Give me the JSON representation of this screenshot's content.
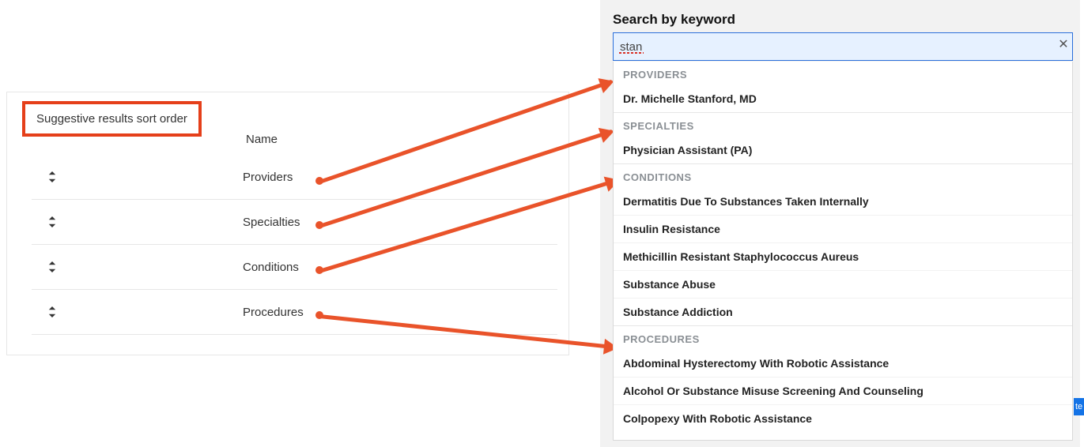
{
  "left": {
    "title": "Suggestive results sort order",
    "column_header": "Name",
    "rows": [
      {
        "label": "Providers"
      },
      {
        "label": "Specialties"
      },
      {
        "label": "Conditions"
      },
      {
        "label": "Procedures"
      }
    ]
  },
  "search": {
    "title": "Search by keyword",
    "value": "stan",
    "clear_glyph": "✕"
  },
  "dropdown": {
    "groups": [
      {
        "header": "PROVIDERS",
        "items": [
          "Dr. Michelle Stanford, MD"
        ]
      },
      {
        "header": "SPECIALTIES",
        "items": [
          "Physician Assistant (PA)"
        ]
      },
      {
        "header": "CONDITIONS",
        "items": [
          "Dermatitis Due To Substances Taken Internally",
          "Insulin Resistance",
          "Methicillin Resistant Staphylococcus Aureus",
          "Substance Abuse",
          "Substance Addiction"
        ]
      },
      {
        "header": "PROCEDURES",
        "items": [
          "Abdominal Hysterectomy With Robotic Assistance",
          "Alcohol Or Substance Misuse Screening And Counseling",
          "Colpopexy With Robotic Assistance"
        ]
      }
    ]
  },
  "edge_badge": "te",
  "annotation": {
    "arrows_map_left_rows_to_dropdown_group_headers": true
  }
}
